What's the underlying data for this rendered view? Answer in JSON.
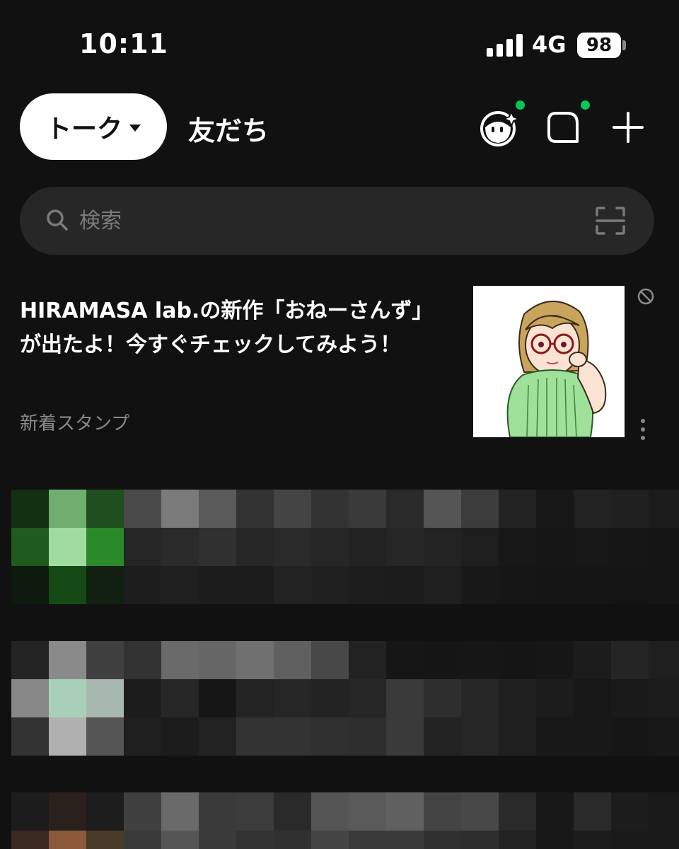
{
  "status_bar": {
    "time": "10:11",
    "network": "4G",
    "battery": "98"
  },
  "header": {
    "talk_tab": "トーク",
    "friends_tab": "友だち",
    "accent_dot_color": "#06c755",
    "icons": [
      "face-sparkle-icon",
      "square-bubble-icon",
      "plus-icon"
    ]
  },
  "search": {
    "placeholder": "検索",
    "icons": [
      "search-icon",
      "scan-icon"
    ]
  },
  "promo": {
    "title": "HIRAMASA lab.の新作「おねーさんず」が出たよ！今すぐチェックしてみよう！",
    "subtitle": "新着スタンプ",
    "image": "sticker-thumbnail"
  },
  "colors": {
    "background": "#111111",
    "search_bg": "#272727",
    "muted_text": "#8a8a8a"
  }
}
